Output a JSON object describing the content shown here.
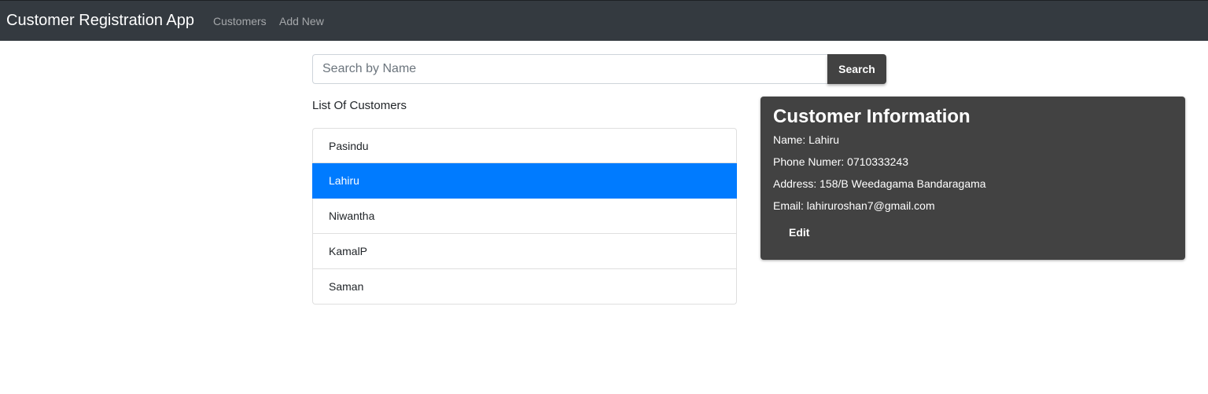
{
  "navbar": {
    "brand": "Customer Registration App",
    "links": [
      "Customers",
      "Add New"
    ]
  },
  "search": {
    "placeholder": "Search by Name",
    "value": "",
    "button_label": "Search"
  },
  "list": {
    "heading": "List Of Customers",
    "items": [
      "Pasindu",
      "Lahiru",
      "Niwantha",
      "KamalP",
      "Saman"
    ],
    "selected": "Lahiru"
  },
  "info": {
    "title": "Customer Information",
    "name_line": "Name: Lahiru",
    "phone_line": "Phone Numer: 0710333243",
    "address_line": "Address: 158/B Weedagama Bandaragama",
    "email_line": "Email: lahiruroshan7@gmail.com",
    "edit_label": "Edit"
  },
  "colors": {
    "navbar_bg": "#343a40",
    "active_item": "#007bff",
    "card_bg": "#424242"
  }
}
